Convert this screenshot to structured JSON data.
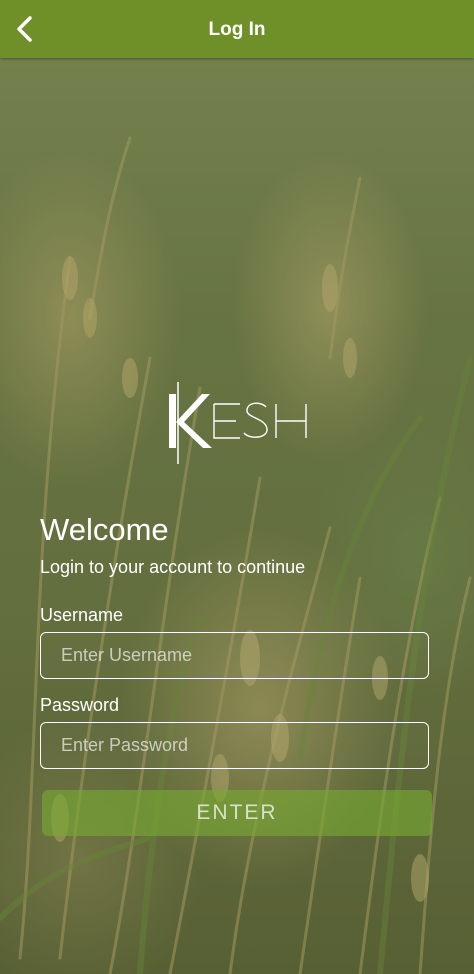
{
  "header": {
    "title": "Log In",
    "back_icon": "chevron-left-icon",
    "color": "#6f8f28"
  },
  "logo": {
    "text": "KESH"
  },
  "login": {
    "welcome": "Welcome",
    "subtitle": "Login to your account to continue",
    "username_label": "Username",
    "username_value": "",
    "username_placeholder": "Enter Username",
    "password_label": "Password",
    "password_value": "",
    "password_placeholder": "Enter Password",
    "enter_label": "ENTER",
    "button_color": "#78aa32"
  }
}
